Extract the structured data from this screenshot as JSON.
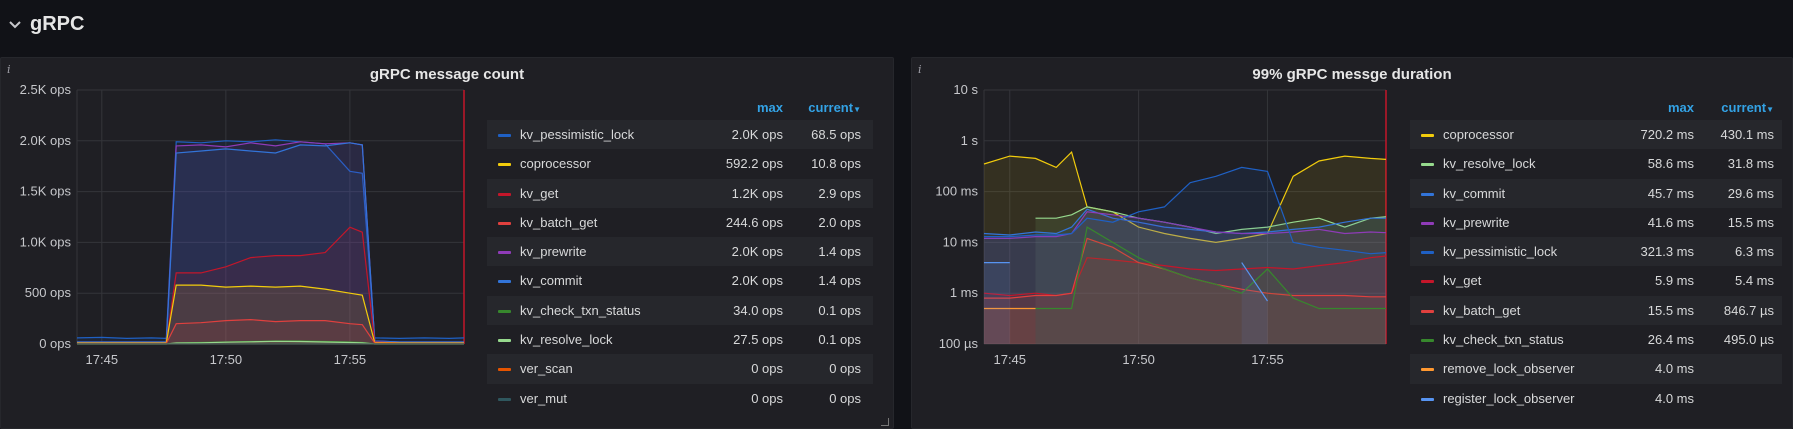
{
  "row": {
    "title": "gRPC"
  },
  "panels": [
    {
      "title": "gRPC message count",
      "legend_headers": {
        "max": "max",
        "current": "current"
      },
      "legend": [
        {
          "name": "kv_pessimistic_lock",
          "color": "#1f60c4",
          "max": "2.0K ops",
          "current": "68.5 ops"
        },
        {
          "name": "coprocessor",
          "color": "#f2cc0c",
          "max": "592.2 ops",
          "current": "10.8 ops"
        },
        {
          "name": "kv_get",
          "color": "#c4162a",
          "max": "1.2K ops",
          "current": "2.9 ops"
        },
        {
          "name": "kv_batch_get",
          "color": "#e0403e",
          "max": "244.6 ops",
          "current": "2.0 ops"
        },
        {
          "name": "kv_prewrite",
          "color": "#8f3bb8",
          "max": "2.0K ops",
          "current": "1.4 ops"
        },
        {
          "name": "kv_commit",
          "color": "#3274d9",
          "max": "2.0K ops",
          "current": "1.4 ops"
        },
        {
          "name": "kv_check_txn_status",
          "color": "#37872d",
          "max": "34.0 ops",
          "current": "0.1 ops"
        },
        {
          "name": "kv_resolve_lock",
          "color": "#96d98d",
          "max": "27.5 ops",
          "current": "0.1 ops"
        },
        {
          "name": "ver_scan",
          "color": "#e55400",
          "max": "0 ops",
          "current": "0 ops"
        },
        {
          "name": "ver_mut",
          "color": "#2f575e",
          "max": "0 ops",
          "current": "0 ops"
        }
      ],
      "chart_data": {
        "type": "area",
        "title": "gRPC message count",
        "xlabel": "",
        "ylabel": "",
        "yticks": [
          "0 ops",
          "500 ops",
          "1.0K ops",
          "1.5K ops",
          "2.0K ops",
          "2.5K ops"
        ],
        "ylim": [
          0,
          2500
        ],
        "xticks": [
          "17:45",
          "17:50",
          "17:55"
        ],
        "x": [
          "17:44.0",
          "17:45.0",
          "17:46.0",
          "17:47.0",
          "17:47.6",
          "17:48.0",
          "17:49.0",
          "17:50.0",
          "17:51.0",
          "17:52.0",
          "17:53.0",
          "17:54.0",
          "17:55.0",
          "17:55.5",
          "17:56.0",
          "17:57.0",
          "17:58.0",
          "17:59.0",
          "17:59.6"
        ],
        "series": [
          {
            "name": "kv_pessimistic_lock",
            "color": "#1f60c4",
            "values": [
              60,
              65,
              55,
              60,
              55,
              1990,
              1980,
              2000,
              1990,
              2010,
              1990,
              1970,
              1700,
              1680,
              60,
              55,
              60,
              55,
              60
            ]
          },
          {
            "name": "kv_prewrite",
            "color": "#8f3bb8",
            "values": [
              20,
              20,
              20,
              20,
              20,
              1950,
              1960,
              1940,
              1980,
              1950,
              1990,
              1970,
              1980,
              1960,
              30,
              20,
              20,
              20,
              20
            ]
          },
          {
            "name": "kv_commit",
            "color": "#3274d9",
            "values": [
              20,
              20,
              20,
              20,
              20,
              1880,
              1900,
              1920,
              1900,
              1880,
              1960,
              1950,
              1980,
              1960,
              30,
              20,
              20,
              20,
              20
            ]
          },
          {
            "name": "kv_get",
            "color": "#c4162a",
            "values": [
              10,
              10,
              10,
              10,
              10,
              700,
              700,
              760,
              850,
              870,
              870,
              900,
              1150,
              1100,
              20,
              10,
              10,
              10,
              10
            ]
          },
          {
            "name": "coprocessor",
            "color": "#f2cc0c",
            "values": [
              10,
              10,
              10,
              10,
              10,
              580,
              580,
              560,
              570,
              560,
              570,
              540,
              500,
              480,
              15,
              10,
              10,
              10,
              10
            ]
          },
          {
            "name": "kv_batch_get",
            "color": "#e0403e",
            "values": [
              5,
              5,
              5,
              5,
              5,
              200,
              210,
              230,
              240,
              220,
              230,
              230,
              200,
              190,
              10,
              5,
              5,
              5,
              5
            ]
          },
          {
            "name": "kv_check_txn_status",
            "color": "#37872d",
            "values": [
              0,
              0,
              0,
              0,
              0,
              10,
              15,
              20,
              25,
              30,
              30,
              25,
              20,
              15,
              0,
              0,
              0,
              0,
              0
            ]
          },
          {
            "name": "kv_resolve_lock",
            "color": "#96d98d",
            "values": [
              0,
              0,
              0,
              0,
              0,
              10,
              12,
              18,
              22,
              27,
              25,
              20,
              15,
              12,
              0,
              0,
              0,
              0,
              0
            ]
          },
          {
            "name": "ver_scan",
            "color": "#e55400",
            "values": [
              0,
              0,
              0,
              0,
              0,
              0,
              0,
              0,
              0,
              0,
              0,
              0,
              0,
              0,
              0,
              0,
              0,
              0,
              0
            ]
          },
          {
            "name": "ver_mut",
            "color": "#2f575e",
            "values": [
              0,
              0,
              0,
              0,
              0,
              0,
              0,
              0,
              0,
              0,
              0,
              0,
              0,
              0,
              0,
              0,
              0,
              0,
              0
            ]
          }
        ]
      }
    },
    {
      "title": "99% gRPC messge duration",
      "legend_headers": {
        "max": "max",
        "current": "current"
      },
      "legend": [
        {
          "name": "coprocessor",
          "color": "#f2cc0c",
          "max": "720.2 ms",
          "current": "430.1 ms"
        },
        {
          "name": "kv_resolve_lock",
          "color": "#96d98d",
          "max": "58.6 ms",
          "current": "31.8 ms"
        },
        {
          "name": "kv_commit",
          "color": "#3274d9",
          "max": "45.7 ms",
          "current": "29.6 ms"
        },
        {
          "name": "kv_prewrite",
          "color": "#8f3bb8",
          "max": "41.6 ms",
          "current": "15.5 ms"
        },
        {
          "name": "kv_pessimistic_lock",
          "color": "#1f60c4",
          "max": "321.3 ms",
          "current": "6.3 ms"
        },
        {
          "name": "kv_get",
          "color": "#c4162a",
          "max": "5.9 ms",
          "current": "5.4 ms"
        },
        {
          "name": "kv_batch_get",
          "color": "#e0403e",
          "max": "15.5 ms",
          "current": "846.7 µs"
        },
        {
          "name": "kv_check_txn_status",
          "color": "#37872d",
          "max": "26.4 ms",
          "current": "495.0 µs"
        },
        {
          "name": "remove_lock_observer",
          "color": "#ff9830",
          "max": "4.0 ms",
          "current": ""
        },
        {
          "name": "register_lock_observer",
          "color": "#5794f2",
          "max": "4.0 ms",
          "current": ""
        }
      ],
      "chart_data": {
        "type": "area",
        "title": "99% gRPC messge duration",
        "yscale": "log",
        "yticks": [
          "100 µs",
          "1 ms",
          "10 ms",
          "100 ms",
          "1 s",
          "10 s"
        ],
        "ylim_seconds": [
          0.0001,
          10
        ],
        "xticks": [
          "17:45",
          "17:50",
          "17:55"
        ],
        "x": [
          "17:44.0",
          "17:45.0",
          "17:46.0",
          "17:46.8",
          "17:47.4",
          "17:48.0",
          "17:49.0",
          "17:50.0",
          "17:51.0",
          "17:52.0",
          "17:53.0",
          "17:54.0",
          "17:55.0",
          "17:56.0",
          "17:57.0",
          "17:58.0",
          "17:59.0",
          "17:59.6"
        ],
        "series": [
          {
            "name": "coprocessor",
            "color": "#f2cc0c",
            "values": [
              0.35,
              0.5,
              0.45,
              0.3,
              0.6,
              0.05,
              0.04,
              0.02,
              0.015,
              0.012,
              0.01,
              0.012,
              0.015,
              0.2,
              0.4,
              0.5,
              0.45,
              0.43
            ]
          },
          {
            "name": "kv_resolve_lock",
            "color": "#96d98d",
            "values": [
              null,
              null,
              0.03,
              0.03,
              0.035,
              0.05,
              0.04,
              0.03,
              0.025,
              0.02,
              0.015,
              0.018,
              0.02,
              0.025,
              0.03,
              0.02,
              0.03,
              0.032
            ]
          },
          {
            "name": "kv_commit",
            "color": "#3274d9",
            "values": [
              0.015,
              0.014,
              0.016,
              0.015,
              0.02,
              0.045,
              0.03,
              0.025,
              0.02,
              0.018,
              0.016,
              0.015,
              0.016,
              0.018,
              0.02,
              0.025,
              0.03,
              0.03
            ]
          },
          {
            "name": "kv_prewrite",
            "color": "#8f3bb8",
            "values": [
              0.012,
              0.012,
              0.013,
              0.013,
              0.015,
              0.04,
              0.035,
              0.03,
              0.025,
              0.02,
              0.016,
              0.015,
              0.015,
              0.016,
              0.018,
              0.015,
              0.016,
              0.0155
            ]
          },
          {
            "name": "kv_pessimistic_lock",
            "color": "#1f60c4",
            "values": [
              0.013,
              0.013,
              0.014,
              0.014,
              0.015,
              0.03,
              0.025,
              0.04,
              0.05,
              0.15,
              0.2,
              0.3,
              0.25,
              0.01,
              0.008,
              0.007,
              0.006,
              0.0063
            ]
          },
          {
            "name": "kv_get",
            "color": "#c4162a",
            "values": [
              0.001,
              0.0009,
              0.001,
              0.0009,
              0.001,
              0.005,
              0.0045,
              0.004,
              0.0035,
              0.003,
              0.0028,
              0.003,
              0.0032,
              0.003,
              0.0035,
              0.004,
              0.005,
              0.0054
            ]
          },
          {
            "name": "kv_batch_get",
            "color": "#e0403e",
            "values": [
              0.0008,
              0.0008,
              0.0009,
              0.0009,
              0.001,
              0.012,
              0.008,
              0.004,
              0.003,
              0.002,
              0.0015,
              0.0012,
              0.001,
              0.0009,
              0.0009,
              0.0009,
              0.00085,
              0.00085
            ]
          },
          {
            "name": "kv_check_txn_status",
            "color": "#37872d",
            "values": [
              null,
              null,
              0.0005,
              0.0005,
              0.0005,
              0.02,
              0.01,
              0.005,
              0.003,
              0.002,
              0.0015,
              0.001,
              0.003,
              0.0008,
              0.0005,
              0.0005,
              0.0005,
              0.0005
            ]
          },
          {
            "name": "remove_lock_observer",
            "color": "#ff9830",
            "values": [
              0.0005,
              0.0005,
              0.0005,
              null,
              null,
              null,
              null,
              null,
              null,
              null,
              null,
              null,
              null,
              null,
              null,
              null,
              null,
              null
            ]
          },
          {
            "name": "register_lock_observer",
            "color": "#5794f2",
            "values": [
              0.004,
              0.004,
              null,
              null,
              null,
              null,
              null,
              null,
              null,
              null,
              null,
              0.004,
              0.0007,
              null,
              null,
              null,
              null,
              null
            ]
          }
        ]
      }
    }
  ]
}
